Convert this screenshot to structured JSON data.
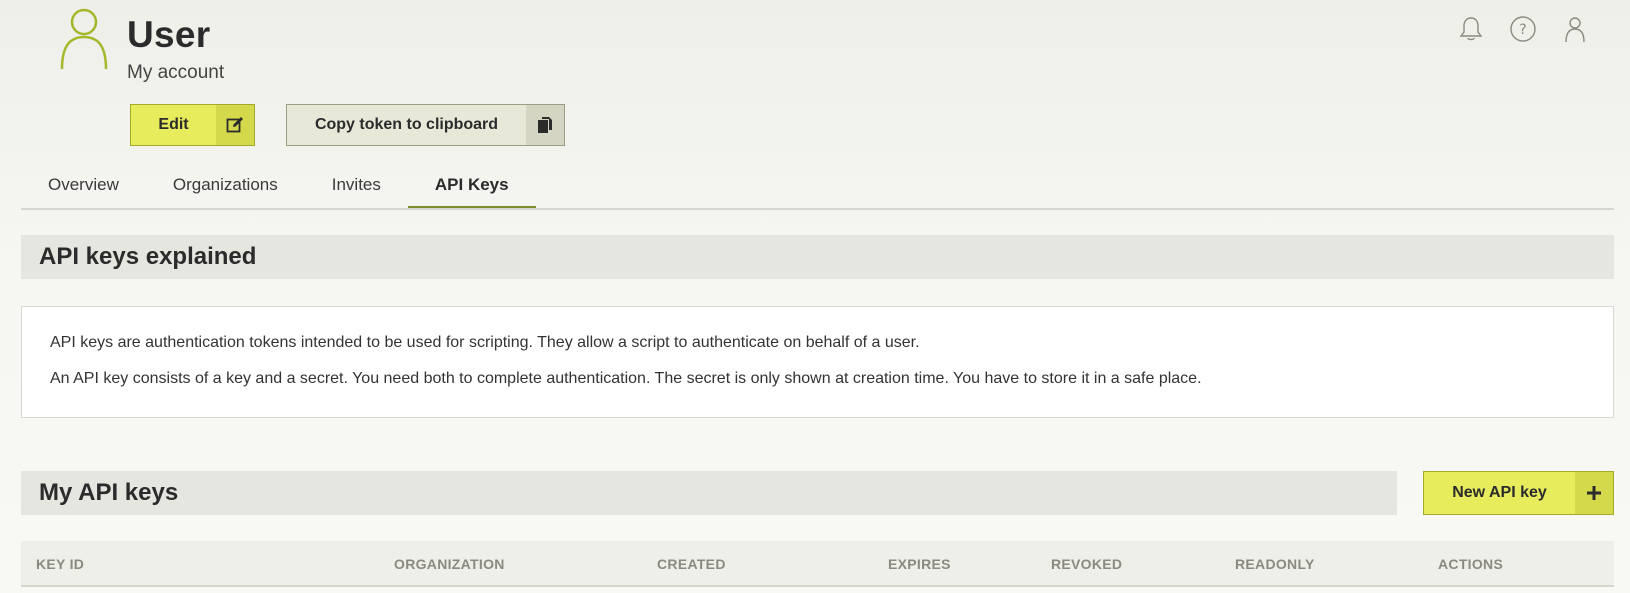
{
  "header": {
    "title": "User",
    "subtitle": "My account",
    "icons": [
      "bell-icon",
      "help-icon",
      "user-icon"
    ]
  },
  "actions": {
    "edit_label": "Edit",
    "edit_icon": "edit-icon",
    "copy_label": "Copy token to clipboard",
    "copy_icon": "clipboard-icon"
  },
  "tabs": [
    {
      "label": "Overview",
      "active": false
    },
    {
      "label": "Organizations",
      "active": false
    },
    {
      "label": "Invites",
      "active": false
    },
    {
      "label": "API Keys",
      "active": true
    }
  ],
  "explained": {
    "title": "API keys explained",
    "paragraphs": [
      "API keys are authentication tokens intended to be used for scripting. They allow a script to authenticate on behalf of a user.",
      "An API key consists of a key and a secret. You need both to complete authentication. The secret is only shown at creation time. You have to store it in a safe place."
    ]
  },
  "my_keys": {
    "title": "My API keys",
    "new_label": "New API key",
    "new_icon": "plus-icon",
    "columns": [
      "KEY ID",
      "ORGANIZATION",
      "CREATED",
      "EXPIRES",
      "REVOKED",
      "READONLY",
      "ACTIONS"
    ]
  },
  "colors": {
    "accent": "#e6ec5c",
    "accent_dark": "#d3d94a",
    "tab_underline": "#7e8b2f",
    "avatar": "#a5b82c"
  }
}
